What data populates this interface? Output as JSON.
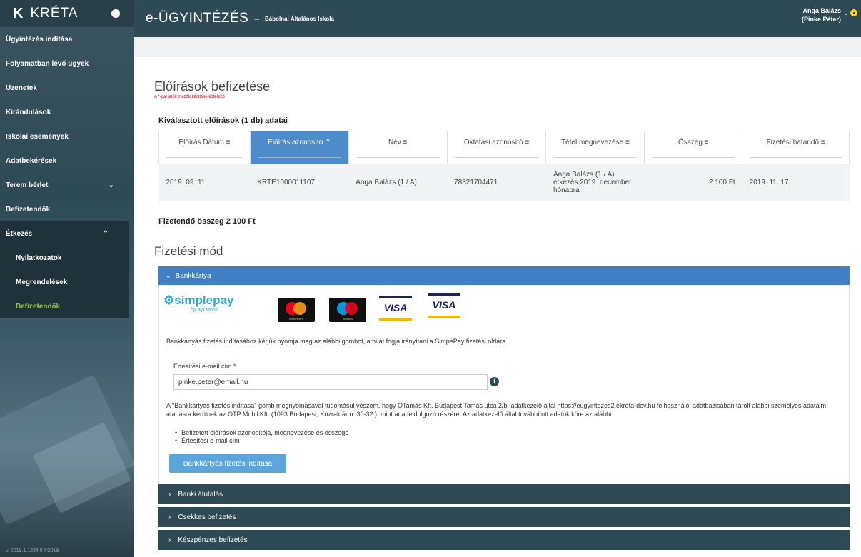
{
  "sidebar": {
    "brand_logo": "K",
    "brand_name": "KRÉTA",
    "items": [
      {
        "label": "Ügyintézés indítása"
      },
      {
        "label": "Folyamatban lévő ügyek"
      },
      {
        "label": "Üzenetek"
      },
      {
        "label": "Kirándulások"
      },
      {
        "label": "Iskolai események"
      },
      {
        "label": "Adatbekérések"
      },
      {
        "label": "Terem bérlet"
      },
      {
        "label": "Befizetendők"
      },
      {
        "label": "Étkezés"
      }
    ],
    "sub_items": [
      {
        "label": "Nyilatkozatok"
      },
      {
        "label": "Megrendelések"
      },
      {
        "label": "Befizetendők"
      }
    ],
    "footer": "v. 2019.1.1234.5 ©2019"
  },
  "header": {
    "app_title": "e-ÜGYINTÉZÉS",
    "separator": "–",
    "school": "Bábolnai Általános Iskola",
    "user_name": "Anga Balázs",
    "user_sub": "(Pinke Péter)"
  },
  "page": {
    "title": "Előírások befizetése",
    "required_note": "A *-gal jelölt mezők kitöltése kötelező",
    "section_title": "Kiválasztott előírások (1 db) adatai",
    "total": "Fizetendő összeg 2 100 Ft",
    "payment_title": "Fizetési mód"
  },
  "table": {
    "columns": [
      "Előírás Dátum",
      "Előírás azonosító",
      "Név",
      "Oktatási azonosító",
      "Tétel megnevezése",
      "Összeg",
      "Fizetési határidő"
    ],
    "rows": [
      [
        "2019. 09. 11.",
        "KRTE1000011107",
        "Anga Balázs (1 / A)",
        "78321704471",
        "Anga Balázs (1 / A) étkezés 2019. december hónapra",
        "2 100 Ft",
        "2019. 11. 17."
      ]
    ]
  },
  "bankcard": {
    "header": "Bankkártya",
    "simplepay": "simplepay",
    "simplepay_sub": "by otp Mobil",
    "mastercard_caption": "mastercard",
    "maestro_caption": "maestro",
    "visa1": "VISA",
    "visa2": "VISA",
    "info": "Bankkártyás fizetés indításához kérjük nyomja meg az alábbi gombot, ami át fogja irányítani a SimpePay fizetési oldara.",
    "email_label": "Értesítési e-mail cím",
    "email_required": "*",
    "email_value": "pinke.peter@email.hu",
    "consent": "A \"Bankkártyás fizetés indítása\" gomb megnyomásával tudomásul veszem, hogy OTamás Kft. Budapest Tamás utca 2/b. adatkezelő által https://eugyintezes2.ekreta-dev.hu felhasználói adatbázisában tárolt alábbi személyes adataim átadásra kerülnek az OTP Mobil Kft. (1093 Budapest, Közraktár u. 30-32.), mint adatfeldolgozó részére. Az adatkezelő által továbbított adatok köre az alábbi:",
    "bullets": [
      "Befizetett előírások azonosítója, megnevezése és összege",
      "Értesítési e-mail cím"
    ],
    "button": "Bankkártyás fizetés indítása"
  },
  "other_methods": [
    {
      "label": "Banki átutalás"
    },
    {
      "label": "Csekkes befizetés"
    },
    {
      "label": "Készpénzes befizetés"
    }
  ]
}
